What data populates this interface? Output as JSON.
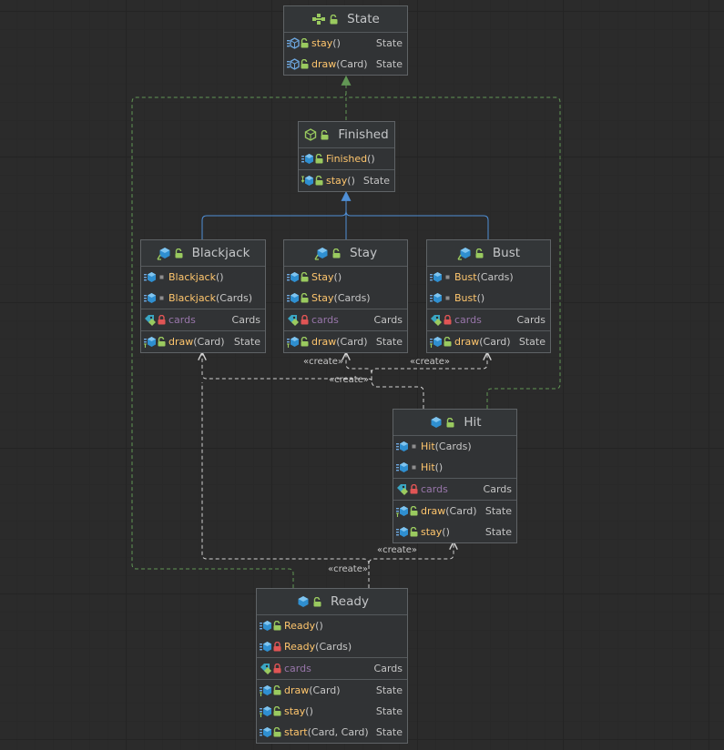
{
  "labels": {
    "create": "«create»"
  },
  "nodes": {
    "state": {
      "title": "State",
      "members": [
        {
          "name": "stay",
          "params": "()",
          "type": "State"
        },
        {
          "name": "draw",
          "params": "(Card)",
          "type": "State"
        }
      ]
    },
    "finished": {
      "title": "Finished",
      "members": [
        {
          "name": "Finished",
          "params": " ()",
          "type": ""
        },
        {
          "name": "stay",
          "params": "()",
          "type": "State"
        }
      ]
    },
    "blackjack": {
      "title": "Blackjack",
      "members": [
        {
          "name": "Blackjack",
          "params": " ()",
          "type": ""
        },
        {
          "name": "Blackjack",
          "params": " (Cards)",
          "type": ""
        },
        {
          "name": "cards",
          "params": "",
          "type": "Cards"
        },
        {
          "name": "draw",
          "params": "(Card)",
          "type": "State"
        }
      ]
    },
    "stay": {
      "title": "Stay",
      "members": [
        {
          "name": "Stay",
          "params": "()",
          "type": ""
        },
        {
          "name": "Stay",
          "params": "(Cards)",
          "type": ""
        },
        {
          "name": "cards",
          "params": "",
          "type": "Cards"
        },
        {
          "name": "draw",
          "params": "(Card)",
          "type": "State"
        }
      ]
    },
    "bust": {
      "title": "Bust",
      "members": [
        {
          "name": "Bust",
          "params": " (Cards)",
          "type": ""
        },
        {
          "name": "Bust",
          "params": " ()",
          "type": ""
        },
        {
          "name": "cards",
          "params": "",
          "type": "Cards"
        },
        {
          "name": "draw",
          "params": "(Card)",
          "type": "State"
        }
      ]
    },
    "hit": {
      "title": "Hit",
      "members": [
        {
          "name": "Hit",
          "params": "(Cards)",
          "type": ""
        },
        {
          "name": "Hit",
          "params": "()",
          "type": ""
        },
        {
          "name": "cards",
          "params": "",
          "type": "Cards"
        },
        {
          "name": "draw",
          "params": "(Card)",
          "type": "State"
        },
        {
          "name": "stay",
          "params": "()",
          "type": "State"
        }
      ]
    },
    "ready": {
      "title": "Ready",
      "members": [
        {
          "name": "Ready",
          "params": "()",
          "type": ""
        },
        {
          "name": "Ready",
          "params": "(Cards)",
          "type": ""
        },
        {
          "name": "cards",
          "params": "",
          "type": "Cards"
        },
        {
          "name": "draw",
          "params": "(Card)",
          "type": "State"
        },
        {
          "name": "stay",
          "params": "()",
          "type": "State"
        },
        {
          "name": "start",
          "params": "(Card, Card)",
          "type": "State"
        }
      ]
    }
  },
  "colors": {
    "background": "#2b2b2b",
    "node_bg": "#313335",
    "method_name": "#ffc66d",
    "field_name": "#9876aa",
    "implements_edge": "#629755",
    "extends_edge": "#4f8fd6",
    "create_edge": "#d2d2d2"
  }
}
